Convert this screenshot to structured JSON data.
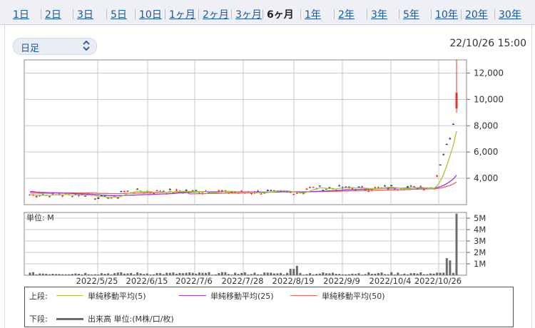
{
  "tabs": [
    {
      "label": "1日"
    },
    {
      "label": "2日"
    },
    {
      "label": "3日"
    },
    {
      "label": "5日"
    },
    {
      "label": "10日"
    },
    {
      "label": "1ヶ月"
    },
    {
      "label": "2ヶ月"
    },
    {
      "label": "3ヶ月"
    },
    {
      "label": "6ヶ月",
      "active": true
    },
    {
      "label": "1年"
    },
    {
      "label": "2年"
    },
    {
      "label": "3年"
    },
    {
      "label": "5年"
    },
    {
      "label": "10年"
    },
    {
      "label": "20年"
    },
    {
      "label": "30年"
    }
  ],
  "select": {
    "value": "日足"
  },
  "timestamp": "22/10/26 15:00",
  "colors": {
    "up": "#e5342a",
    "down": "#2e3f7a",
    "ma5": "#a5c83a",
    "ma25": "#9a36d9",
    "ma50": "#f0625e",
    "volume": "#6b6b6b",
    "grid": "#c8c8c8"
  },
  "chart_data": [
    {
      "type": "candlestick",
      "x_ticks": [
        "2022/5/25",
        "2022/6/15",
        "2022/7/6",
        "2022/7/28",
        "2022/8/19",
        "2022/9/9",
        "2022/10/4",
        "2022/10/26"
      ],
      "y_ticks": [
        "4,000",
        "6,000",
        "8,000",
        "10,000",
        "12,000"
      ],
      "ylim": [
        2000,
        13000
      ],
      "points": [
        {
          "x": "2022/10/18",
          "y": 4200
        },
        {
          "x": "2022/10/19",
          "y": 5000
        },
        {
          "x": "2022/10/20",
          "y": 5800
        },
        {
          "x": "2022/10/21",
          "y": 6600
        },
        {
          "x": "2022/10/24",
          "y": 7000
        },
        {
          "x": "2022/10/25",
          "y": 8100
        },
        {
          "x": "2022/10/26",
          "o": 9300,
          "h": 13000,
          "l": 9000,
          "c": 10500
        }
      ],
      "series": [
        {
          "name": "単純移動平均(5)"
        },
        {
          "name": "単純移動平均(25)"
        },
        {
          "name": "単純移動平均(50)"
        }
      ]
    },
    {
      "type": "bar",
      "unit_label": "単位: M",
      "y_ticks": [
        "1M",
        "2M",
        "3M",
        "4M",
        "5M"
      ],
      "ylim": [
        0,
        5.5
      ],
      "values": [
        {
          "x": "2022/10/21",
          "v": 1.5
        },
        {
          "x": "2022/10/24",
          "v": 1.3
        },
        {
          "x": "2022/10/26",
          "v": 5.4
        }
      ]
    }
  ],
  "legend": {
    "top_label": "上段:",
    "bottom_label": "下段:",
    "volume_label": "出来高 単位:(M株/口/枚)"
  }
}
